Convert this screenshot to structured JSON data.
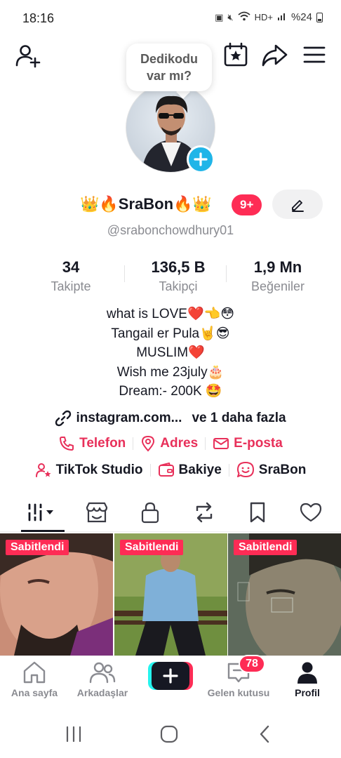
{
  "status_bar": {
    "time": "18:16",
    "battery": "%24",
    "icons": [
      "sim-icon",
      "mute-icon",
      "wifi-icon",
      "hd-voice-icon",
      "signal-icon",
      "battery-icon"
    ]
  },
  "header": {
    "bubble_line1": "Dedikodu",
    "bubble_line2": "var mı?"
  },
  "profile": {
    "display_name": "👑🔥SraBon🔥👑",
    "notification_count": "9+",
    "username": "@srabonchowdhury01"
  },
  "stats": [
    {
      "value": "34",
      "label": "Takipte"
    },
    {
      "value": "136,5 B",
      "label": "Takipçi"
    },
    {
      "value": "1,9 Mn",
      "label": "Beğeniler"
    }
  ],
  "bio": [
    "what is LOVE❤️👈😳",
    "Tangail er Pula🤘😎",
    "MUSLIM❤️",
    "Wish me 23july🎂",
    "Dream:- 200K 🤩"
  ],
  "link": {
    "text": "instagram.com...",
    "more": "ve 1 daha fazla"
  },
  "contact": {
    "phone": "Telefon",
    "address": "Adres",
    "email": "E-posta"
  },
  "tools": {
    "studio": "TikTok Studio",
    "balance": "Bakiye",
    "account": "SraBon"
  },
  "tabs": [
    "videos",
    "shop",
    "private",
    "reposts",
    "favorites",
    "liked"
  ],
  "grid": [
    {
      "badge": "Sabitlendi"
    },
    {
      "badge": "Sabitlendi"
    },
    {
      "badge": "Sabitlendi"
    }
  ],
  "bottom_nav": {
    "home": "Ana sayfa",
    "friends": "Arkadaşlar",
    "inbox": "Gelen kutusu",
    "inbox_count": "78",
    "profile": "Profil"
  },
  "colors": {
    "accent": "#fe2c55",
    "cyan": "#25f4ee",
    "text": "#161823",
    "muted": "#8a8b91"
  }
}
